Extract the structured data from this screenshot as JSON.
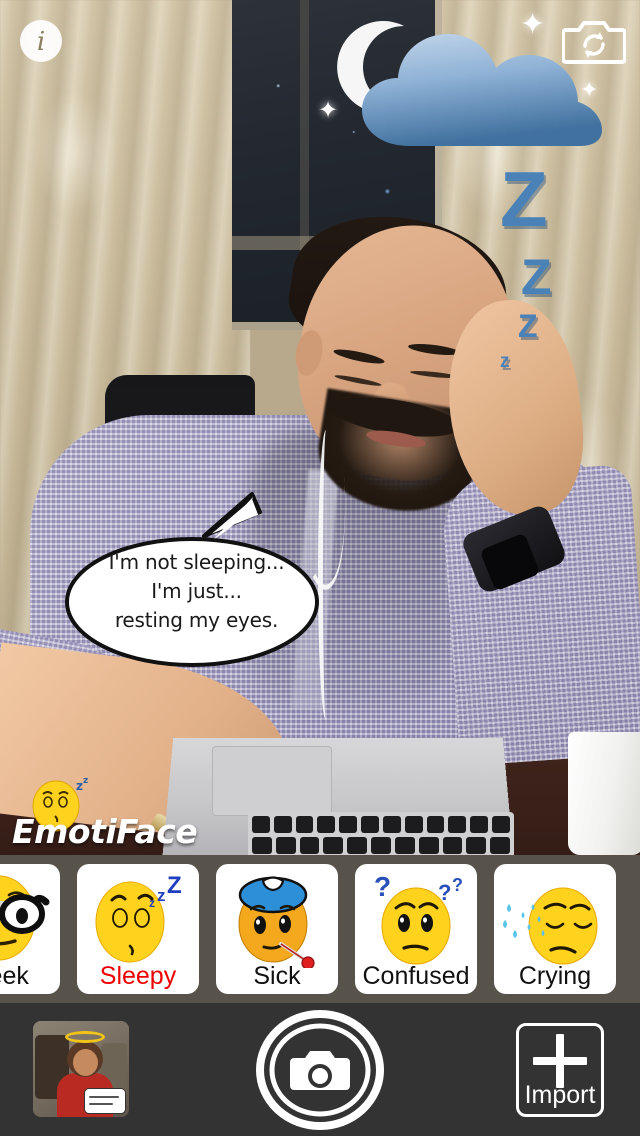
{
  "app": {
    "name": "EmotiFace",
    "watermark_text": "EmotiFace"
  },
  "top_controls": {
    "info_label": "i",
    "info_icon": "info-icon",
    "flip_camera_icon": "flip-camera-icon"
  },
  "photo": {
    "overlay_stickers": [
      "cloud-sticker",
      "moon-sticker",
      "zzz-sticker",
      "speech-bubble-sticker"
    ],
    "zzz": [
      "Z",
      "Z",
      "Z",
      "z"
    ],
    "speech_bubble": {
      "line1": "I'm not sleeping...",
      "line2": "I'm just...",
      "line3": "resting my eyes."
    }
  },
  "emoji_strip": {
    "selected": "Sleepy",
    "tiles": [
      {
        "label": "Geek",
        "icon": "geek-emoji-icon",
        "selected": false
      },
      {
        "label": "Sleepy",
        "icon": "sleepy-emoji-icon",
        "selected": true
      },
      {
        "label": "Sick",
        "icon": "sick-emoji-icon",
        "selected": false
      },
      {
        "label": "Confused",
        "icon": "confused-emoji-icon",
        "selected": false
      },
      {
        "label": "Crying",
        "icon": "crying-emoji-icon",
        "selected": false
      }
    ]
  },
  "bottom_bar": {
    "gallery_thumbnail_icon": "gallery-thumbnail",
    "shutter_icon": "camera-shutter-icon",
    "import": {
      "label": "Import",
      "icon": "plus-icon"
    }
  },
  "colors": {
    "selected_label": "#ee0000",
    "strip_background": "#57534a",
    "bar_background": "#333333",
    "sticker_blue": "#4a82b8",
    "cloud_light": "#a3c0de",
    "cloud_dark": "#4d7ba8",
    "emoji_yellow": "#ffd21e"
  }
}
